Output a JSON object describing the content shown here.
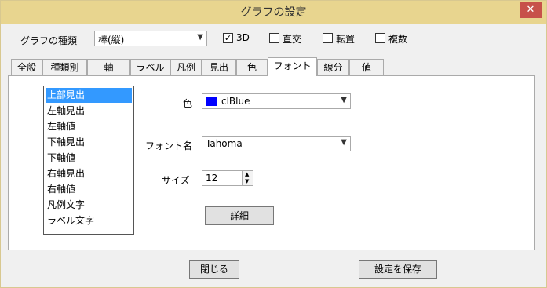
{
  "window": {
    "title": "グラフの設定",
    "close_label": "✕"
  },
  "toolbar": {
    "chart_type_label": "グラフの種類",
    "chart_type_value": "棒(縦)",
    "checkboxes": [
      {
        "label": "3D",
        "checked": true
      },
      {
        "label": "直交",
        "checked": false
      },
      {
        "label": "転置",
        "checked": false
      },
      {
        "label": "複数",
        "checked": false
      }
    ]
  },
  "tabs": [
    "全般",
    "種類別",
    "軸",
    "ラベル",
    "凡例",
    "見出",
    "色",
    "フォント",
    "線分",
    "値"
  ],
  "active_tab": "フォント",
  "font_panel": {
    "items": [
      "上部見出",
      "左軸見出",
      "左軸値",
      "下軸見出",
      "下軸値",
      "右軸見出",
      "右軸値",
      "凡例文字",
      "ラベル文字"
    ],
    "selected_item": "上部見出",
    "color_label": "色",
    "color_value": "clBlue",
    "color_swatch": "#0000ff",
    "font_name_label": "フォント名",
    "font_name_value": "Tahoma",
    "size_label": "サイズ",
    "size_value": "12",
    "detail_button": "詳細"
  },
  "footer": {
    "close_button": "閉じる",
    "save_button": "設定を保存"
  }
}
